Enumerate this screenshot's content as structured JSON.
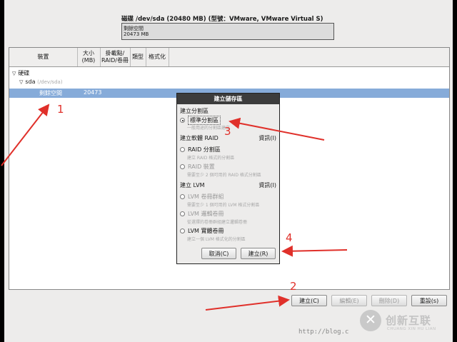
{
  "disk": {
    "title": "磁碟 /dev/sda (20480 MB) (型號：VMware, VMware Virtual S)",
    "bar_line1": "剩餘空間",
    "bar_line2": "20473 MB"
  },
  "table": {
    "headers": [
      "裝置",
      "大小\n(MB)",
      "掛載點/\nRAID/卷冊",
      "類型",
      "格式化"
    ],
    "rows": [
      {
        "device": "硬碟",
        "level": 0
      },
      {
        "device": "sda",
        "extra": "(/dev/sda)",
        "level": 1
      },
      {
        "device": "剩餘空間",
        "size": "20473",
        "level": 2,
        "selected": true
      }
    ]
  },
  "buttons": {
    "create": "建立(C)",
    "edit": "編輯(E)",
    "delete": "刪除(D)",
    "reset": "重設(s)"
  },
  "dialog": {
    "title": "建立儲存區",
    "section_partition": "建立分割區",
    "opt_standard": "標準分割區",
    "hint_standard": "一般用途的分割區建立",
    "section_raid": "建立軟體 RAID",
    "info_raid": "資訊(I)",
    "opt_raid_partition": "RAID 分割區",
    "hint_raid_partition": "建立 RAID 格式的分割區",
    "opt_raid_device": "RAID 裝置",
    "hint_raid_device": "需要至少 2 個可用的 RAID 格式分割區",
    "section_lvm": "建立 LVM",
    "info_lvm": "資訊(I)",
    "opt_lvm_vg": "LVM 卷冊群組",
    "hint_lvm_vg": "需要至少 1 個可用的 LVM 格式分割區",
    "opt_lvm_lv": "LVM 邏輯卷冊",
    "hint_lvm_lv": "從選擇的卷冊群組建立邏輯卷冊",
    "opt_lvm_pv": "LVM 實體卷冊",
    "hint_lvm_pv": "建立一個 LVM 格式化的分割區",
    "cancel": "取消(C)",
    "create": "建立(R)"
  },
  "annotations": {
    "n1": "1",
    "n2": "2",
    "n3": "3",
    "n4": "4",
    "color": "#e0302a"
  },
  "watermark": {
    "url": "http://blog.c",
    "cn": "创新互联",
    "en": "CHUANG XIN HU LIAN"
  }
}
